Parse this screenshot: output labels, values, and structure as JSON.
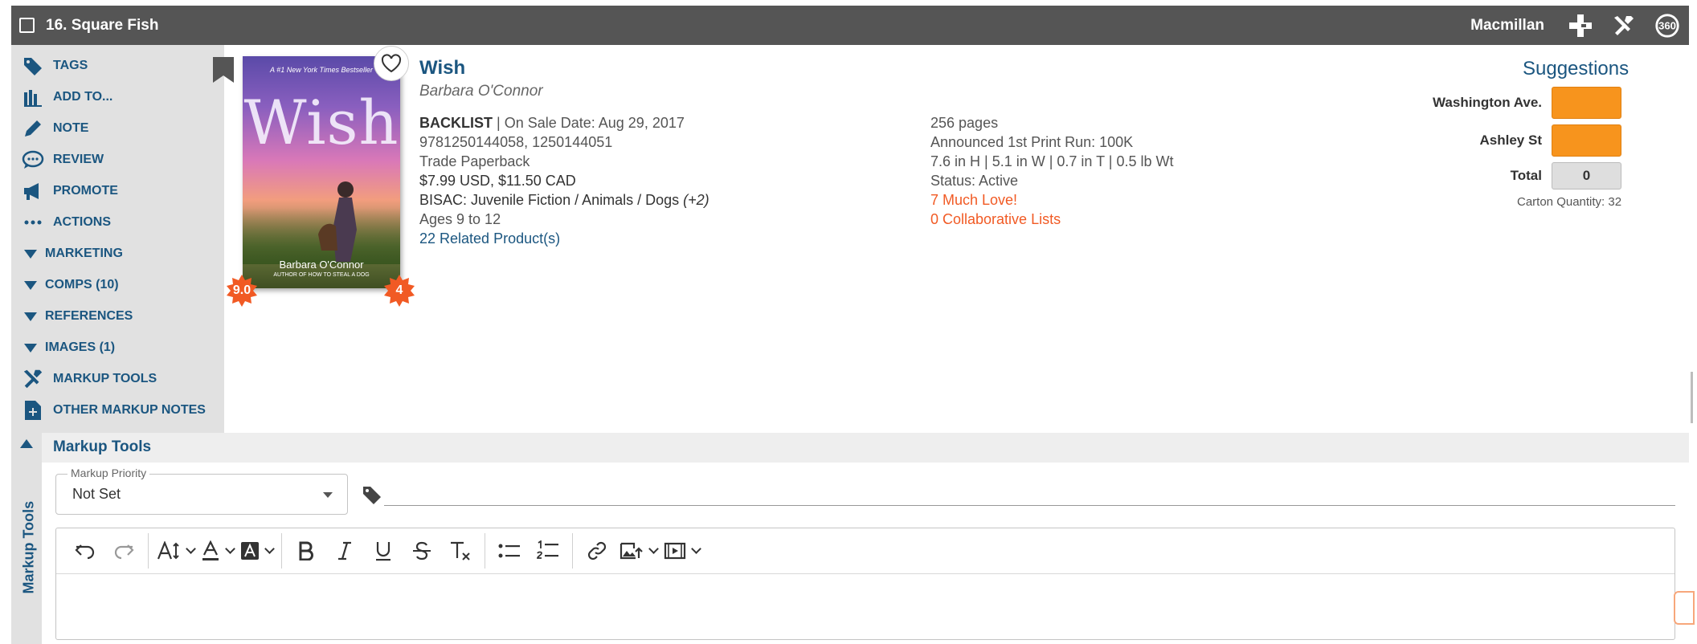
{
  "header": {
    "group_title": "16. Square Fish",
    "publisher": "Macmillan",
    "icons": [
      "add-medical-cross-icon",
      "tools-icon",
      "360-icon"
    ],
    "icon_360_label": "360"
  },
  "sidebar": {
    "items": [
      {
        "label": "TAGS",
        "icon": "tag-icon"
      },
      {
        "label": "ADD TO...",
        "icon": "books-icon"
      },
      {
        "label": "NOTE",
        "icon": "pencil-icon"
      },
      {
        "label": "REVIEW",
        "icon": "speech-bubble-icon"
      },
      {
        "label": "PROMOTE",
        "icon": "megaphone-icon"
      },
      {
        "label": "ACTIONS",
        "icon": "more-dots-icon"
      },
      {
        "label": "MARKETING",
        "icon": "caret-down-icon"
      },
      {
        "label": "COMPS (10)",
        "icon": "caret-down-icon"
      },
      {
        "label": "REFERENCES",
        "icon": "caret-down-icon"
      },
      {
        "label": "IMAGES (1)",
        "icon": "caret-down-icon"
      },
      {
        "label": "MARKUP TOOLS",
        "icon": "tools-icon"
      },
      {
        "label": "OTHER MARKUP NOTES",
        "icon": "add-note-icon"
      }
    ]
  },
  "cover": {
    "tagline": "A #1 New York Times Bestseller",
    "title": "Wish",
    "author": "Barbara O'Connor",
    "subtitle": "AUTHOR OF HOW TO STEAL A DOG",
    "left_badge": "9.0",
    "right_badge": "4"
  },
  "book": {
    "title": "Wish",
    "author": "Barbara O'Connor",
    "status_tag": "BACKLIST",
    "on_sale": "| On Sale Date: Aug 29, 2017",
    "isbns": "9781250144058, 1250144051",
    "format": "Trade Paperback",
    "price": "$7.99 USD, $11.50 CAD",
    "bisac_label": "BISAC: Juvenile Fiction / Animals / Dogs",
    "bisac_more": "(+2)",
    "ages": "Ages 9 to 12",
    "related": "22 Related Product(s)",
    "pages": "256 pages",
    "print_run": "Announced 1st Print Run: 100K",
    "dimensions": "7.6 in H | 5.1 in W | 0.7 in T | 0.5 lb Wt",
    "status": "Status: Active",
    "much_love": "7 Much Love!",
    "collab_lists": "0 Collaborative Lists"
  },
  "suggestions": {
    "heading": "Suggestions",
    "rows": [
      {
        "label": "Washington Ave."
      },
      {
        "label": "Ashley St"
      }
    ],
    "total_label": "Total",
    "total_value": "0",
    "carton": "Carton Quantity: 32"
  },
  "markup": {
    "side_label": "Markup Tools",
    "heading": "Markup Tools",
    "priority_label": "Markup Priority",
    "priority_value": "Not Set",
    "tag_value": "",
    "editor_content": ""
  },
  "colors": {
    "header_bg": "#555555",
    "sidebar_bg": "#e1e1e1",
    "link_blue": "#1b5680",
    "accent_orange": "#f15a24",
    "suggestion_box": "#f7941d"
  }
}
